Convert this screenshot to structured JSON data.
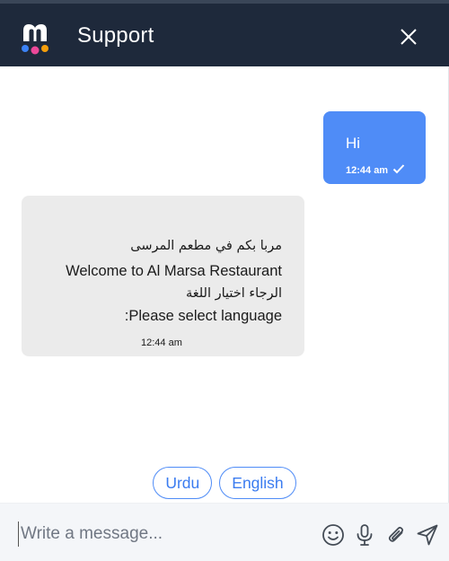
{
  "header": {
    "title": "Support"
  },
  "messages": {
    "outgoing": {
      "text": "Hi",
      "time": "12:44 am"
    },
    "incoming": {
      "line1": "مربا بكم في مطعم المرسى",
      "line2": "Welcome to Al Marsa Restaurant",
      "line3": "الرجاء اختيار اللغة",
      "line4": ":Please select language",
      "time": "12:44 am"
    }
  },
  "quick_replies": [
    "Urdu",
    "English"
  ],
  "composer": {
    "placeholder": "Write a message..."
  },
  "icons": {
    "logo": "brand-m-logo-icon",
    "close": "close-icon",
    "check": "check-icon",
    "emoji": "smiley-icon",
    "mic": "microphone-icon",
    "attach": "paperclip-icon",
    "send": "send-icon"
  },
  "colors": {
    "header_bg": "#1e293b",
    "accent": "#4f8cf7",
    "incoming_bg": "#ebebeb",
    "logo_dot_blue": "#3b82f6",
    "logo_dot_pink": "#ec4899",
    "logo_dot_orange": "#f59e0b"
  }
}
